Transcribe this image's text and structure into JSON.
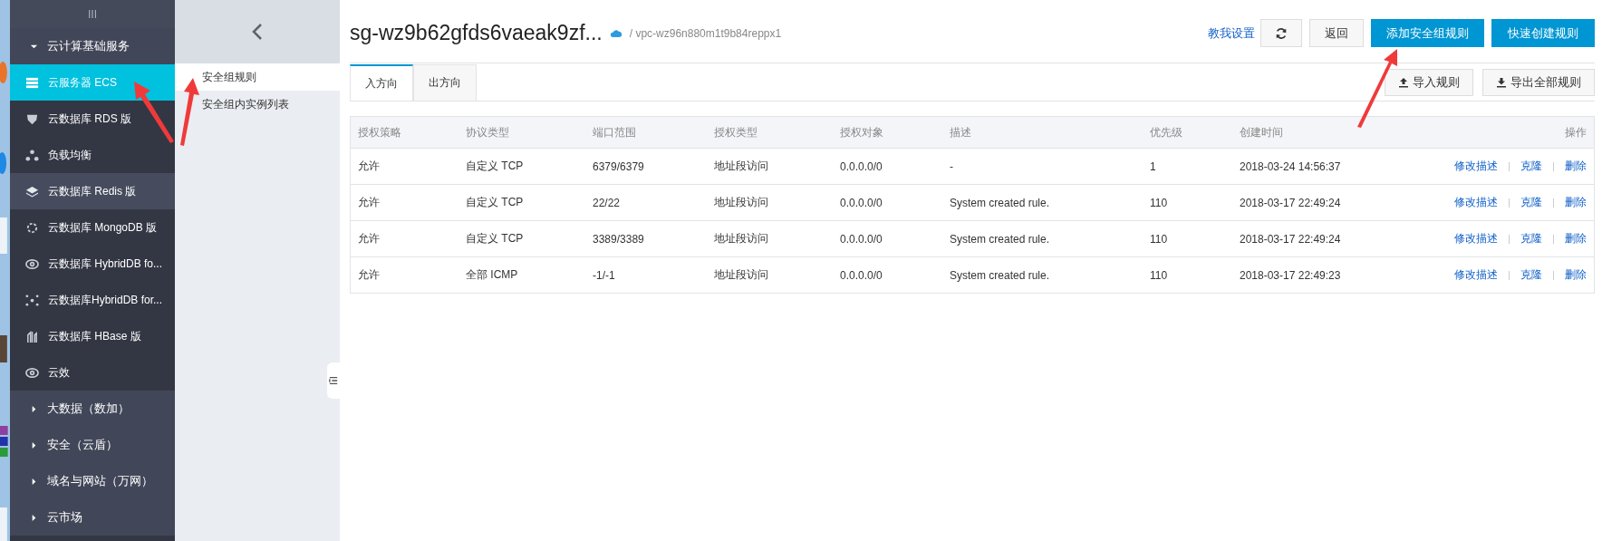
{
  "sidebar": {
    "handle": "III",
    "groups": [
      {
        "label": "云计算基础服务",
        "expanded": true,
        "children": [
          {
            "label": "云服务器 ECS",
            "selected": true,
            "highlighted": false
          },
          {
            "label": "云数据库 RDS 版",
            "selected": false,
            "highlighted": false
          },
          {
            "label": "负载均衡",
            "selected": false,
            "highlighted": false
          },
          {
            "label": "云数据库 Redis 版",
            "selected": false,
            "highlighted": true
          },
          {
            "label": "云数据库 MongoDB 版",
            "selected": false,
            "highlighted": false
          },
          {
            "label": "云数据库 HybridDB fo...",
            "selected": false,
            "highlighted": false
          },
          {
            "label": "云数据库HybridDB for...",
            "selected": false,
            "highlighted": false
          },
          {
            "label": "云数据库 HBase 版",
            "selected": false,
            "highlighted": false
          },
          {
            "label": "云效",
            "selected": false,
            "highlighted": false
          }
        ]
      },
      {
        "label": "大数据（数加）",
        "expanded": false
      },
      {
        "label": "安全（云盾）",
        "expanded": false
      },
      {
        "label": "域名与网站（万网）",
        "expanded": false
      },
      {
        "label": "云市场",
        "expanded": false
      }
    ]
  },
  "subnav": {
    "items": [
      {
        "label": "安全组规则",
        "selected": true
      },
      {
        "label": "安全组内实例列表",
        "selected": false
      }
    ]
  },
  "header": {
    "title": "sg-wz9b62gfds6vaeak9zf...",
    "vpc": "/ vpc-wz96n880m1t9b84reppx1",
    "help_link": "教我设置",
    "buttons": [
      {
        "label": "返回",
        "kind": "default"
      },
      {
        "label": "添加安全组规则",
        "kind": "primary"
      },
      {
        "label": "快速创建规则",
        "kind": "primary"
      }
    ]
  },
  "tabs": [
    {
      "label": "入方向",
      "selected": true
    },
    {
      "label": "出方向",
      "selected": false
    }
  ],
  "tools": [
    {
      "label": "导入规则",
      "kind": "upload"
    },
    {
      "label": "导出全部规则",
      "kind": "download"
    }
  ],
  "table": {
    "columns": [
      "授权策略",
      "协议类型",
      "端口范围",
      "授权类型",
      "授权对象",
      "描述",
      "优先级",
      "创建时间",
      "操作"
    ],
    "rows": [
      {
        "cells": [
          "允许",
          "自定义 TCP",
          "6379/6379",
          "地址段访问",
          "0.0.0.0/0",
          "-",
          "1",
          "2018-03-24 14:56:37"
        ],
        "actions": [
          "修改描述",
          "克隆",
          "删除"
        ]
      },
      {
        "cells": [
          "允许",
          "自定义 TCP",
          "22/22",
          "地址段访问",
          "0.0.0.0/0",
          "System created rule.",
          "110",
          "2018-03-17 22:49:24"
        ],
        "actions": [
          "修改描述",
          "克隆",
          "删除"
        ]
      },
      {
        "cells": [
          "允许",
          "自定义 TCP",
          "3389/3389",
          "地址段访问",
          "0.0.0.0/0",
          "System created rule.",
          "110",
          "2018-03-17 22:49:24"
        ],
        "actions": [
          "修改描述",
          "克隆",
          "删除"
        ]
      },
      {
        "cells": [
          "允许",
          "全部 ICMP",
          "-1/-1",
          "地址段访问",
          "0.0.0.0/0",
          "System created rule.",
          "110",
          "2018-03-17 22:49:23"
        ],
        "actions": [
          "修改描述",
          "克隆",
          "删除"
        ]
      }
    ]
  }
}
